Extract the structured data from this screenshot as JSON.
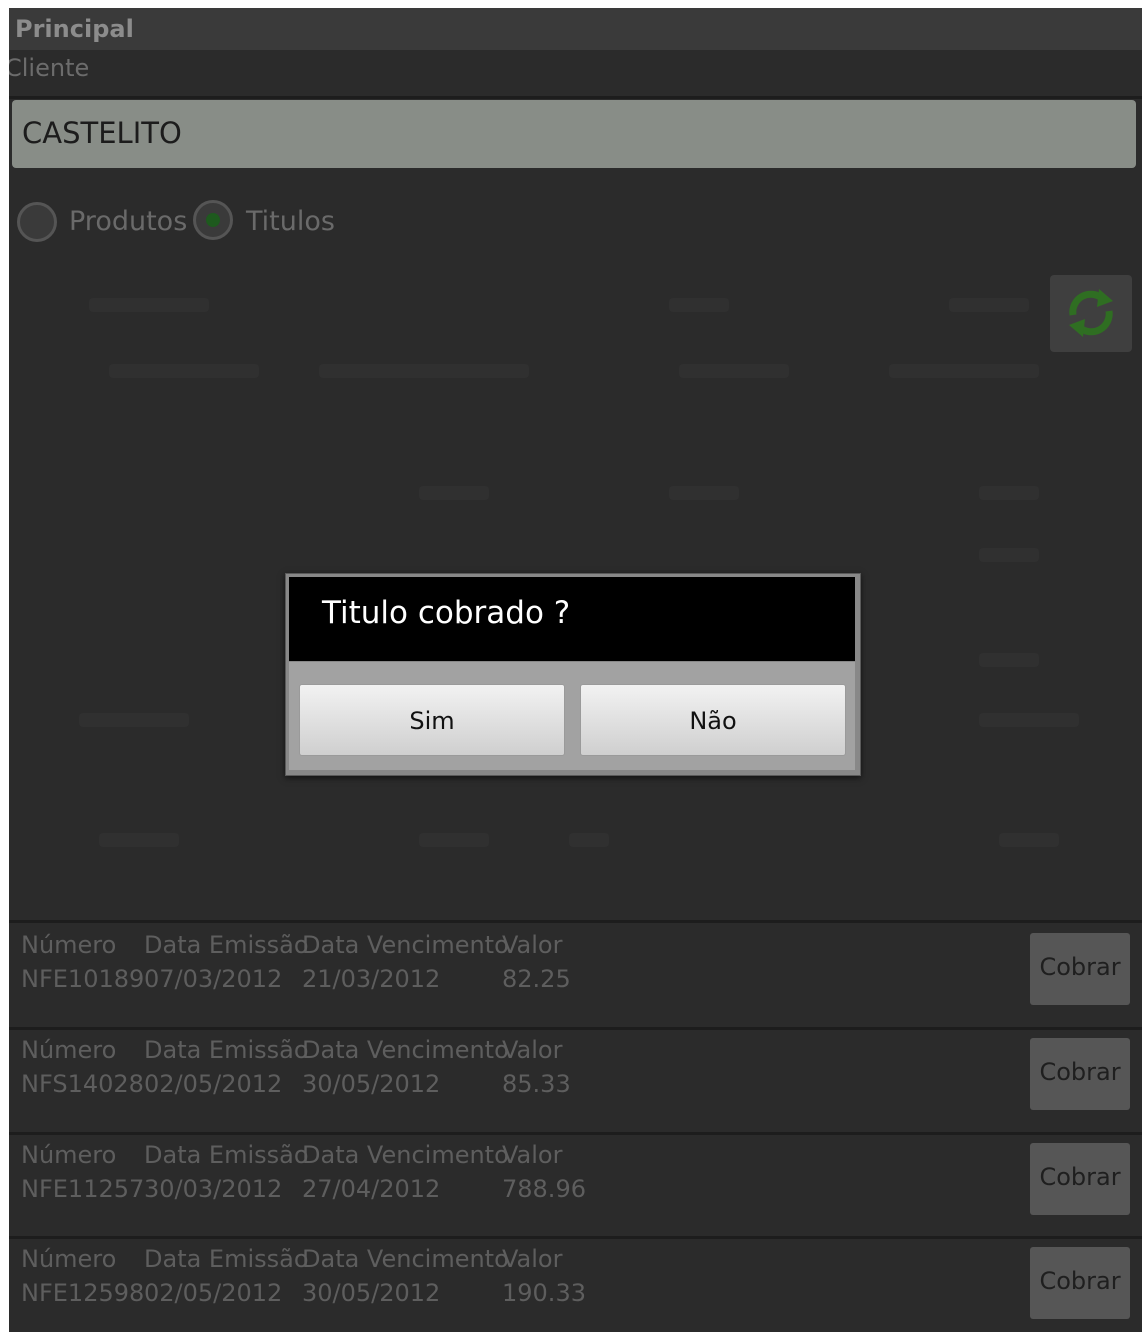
{
  "app": {
    "title": "Principal"
  },
  "cliente": {
    "label": "Cliente",
    "value": "CASTELITO"
  },
  "filter": {
    "option_produtos": "Produtos",
    "option_titulos": "Titulos",
    "selected": "Titulos"
  },
  "titles_list": {
    "headers": {
      "numero": "Número",
      "emissao": "Data Emissão",
      "vencimento": "Data Vencimento",
      "valor": "Valor"
    },
    "action_label": "Cobrar",
    "rows": [
      {
        "numero": "NFE10189",
        "emissao": "07/03/2012",
        "vencimento": "21/03/2012",
        "valor": "82.25"
      },
      {
        "numero": "NFS14028",
        "emissao": "02/05/2012",
        "vencimento": "30/05/2012",
        "valor": "85.33"
      },
      {
        "numero": "NFE11257",
        "emissao": "30/03/2012",
        "vencimento": "27/04/2012",
        "valor": "788.96"
      },
      {
        "numero": "NFE12598",
        "emissao": "02/05/2012",
        "vencimento": "30/05/2012",
        "valor": "190.33"
      }
    ]
  },
  "dialog": {
    "title": "Titulo cobrado ?",
    "confirm_label": "Sim",
    "cancel_label": "Não"
  },
  "icons": {
    "refresh": "refresh-icon"
  },
  "colors": {
    "radio_selected": "#3a9a2a",
    "refresh_arrows": "#3f9a2e",
    "dialog_title_bg": "#000000"
  }
}
